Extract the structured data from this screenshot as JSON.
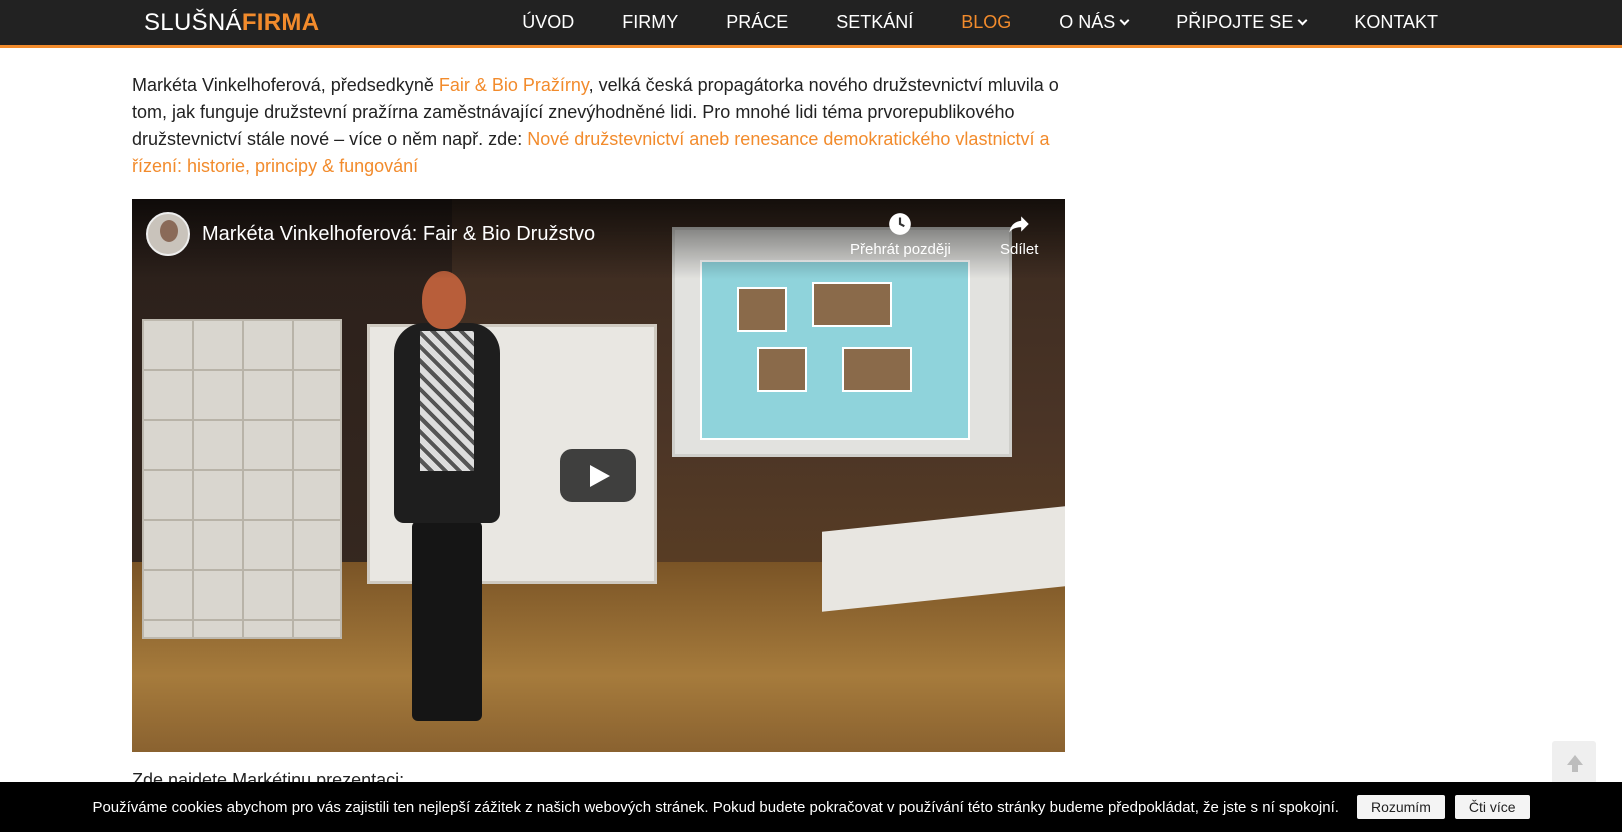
{
  "header": {
    "logo_prefix": "SLUŠNÁ",
    "logo_suffix": "FIRMA",
    "nav": [
      {
        "label": "ÚVOD",
        "active": false,
        "dropdown": false
      },
      {
        "label": "FIRMY",
        "active": false,
        "dropdown": false
      },
      {
        "label": "PRÁCE",
        "active": false,
        "dropdown": false
      },
      {
        "label": "SETKÁNÍ",
        "active": false,
        "dropdown": false
      },
      {
        "label": "BLOG",
        "active": true,
        "dropdown": false
      },
      {
        "label": "O NÁS",
        "active": false,
        "dropdown": true
      },
      {
        "label": "PŘIPOJTE SE",
        "active": false,
        "dropdown": true
      },
      {
        "label": "KONTAKT",
        "active": false,
        "dropdown": false
      }
    ]
  },
  "article": {
    "p1_a": "Markéta Vinkelhoferová, předsedkyně ",
    "p1_link1": "Fair & Bio Pražírny",
    "p1_b": ", velká česká propagátorka nového družstevnictví mluvila o tom, jak funguje družstevní pražírna zaměstnávající znevýhodněné lidi. Pro mnohé lidi téma prvorepublikového družstevnictví stále nové – více o něm např. zde: ",
    "p1_link2": "Nové družstevnictví aneb renesance demokratického vlastnictví a řízení: historie, principy & fungování",
    "trailing": "Zde najdete Markétinu prezentaci:"
  },
  "video": {
    "title": "Markéta Vinkelhoferová: Fair & Bio Družstvo",
    "watch_later": "Přehrát později",
    "share": "Sdílet",
    "play_icon": "play-icon",
    "clock_icon": "clock-icon",
    "share_icon": "share-icon"
  },
  "cookie": {
    "text": "Používáme cookies abychom pro vás zajistili ten nejlepší zážitek z našich webových stránek. Pokud budete pokračovat v používání této stránky budeme předpokládat, že jste s ní spokojní.",
    "accept": "Rozumím",
    "more": "Čti více"
  },
  "colors": {
    "accent": "#f28b2c",
    "header_bg": "#222222",
    "cookie_bg": "#000000"
  }
}
